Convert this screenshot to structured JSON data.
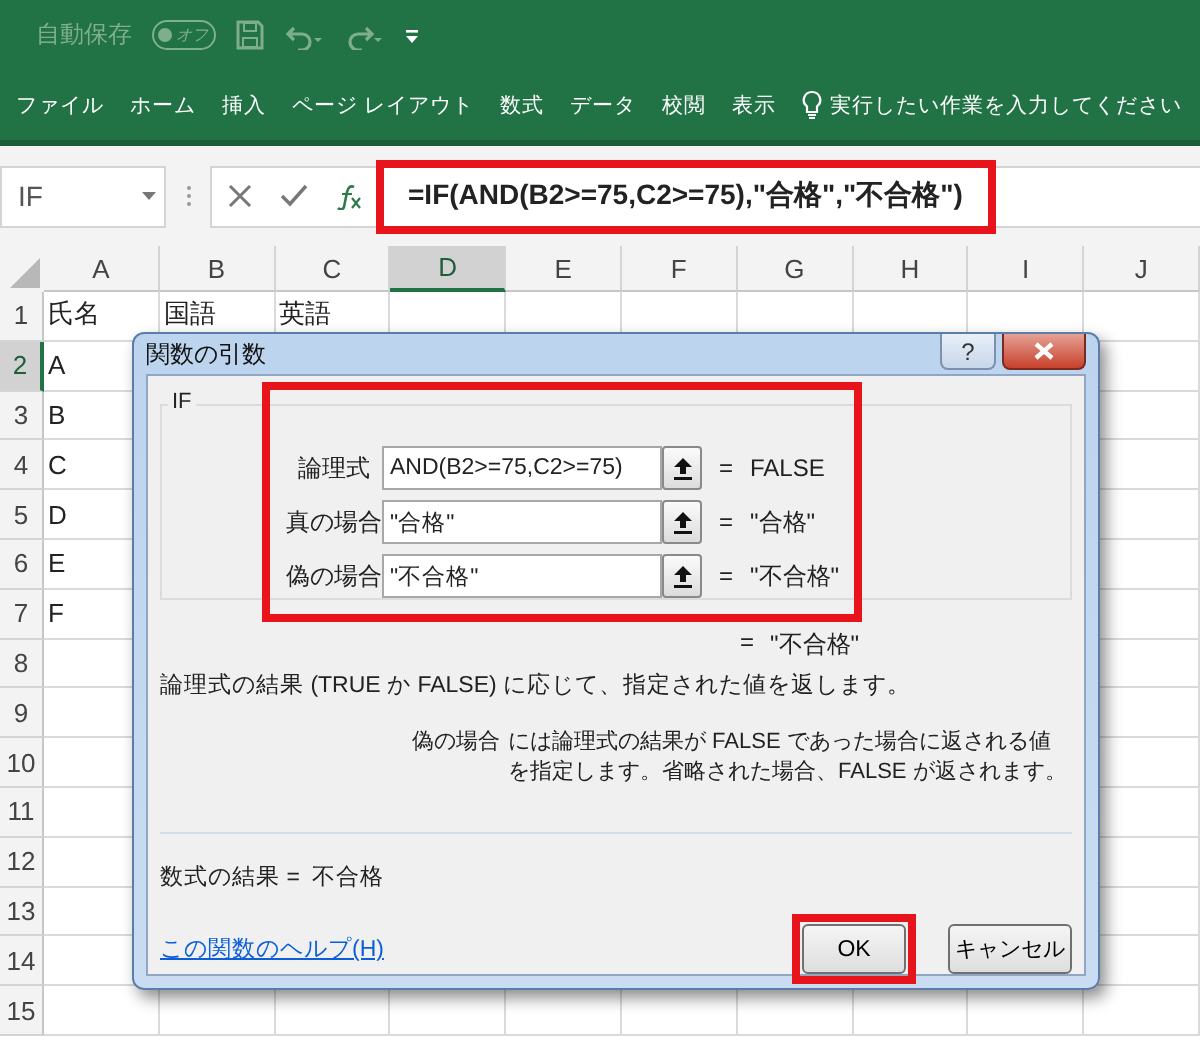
{
  "quick_access": {
    "autosave_label": "自動保存",
    "autosave_state": "オフ",
    "autosave_on": false
  },
  "ribbon_tabs": [
    {
      "label": "ファイル"
    },
    {
      "label": "ホーム"
    },
    {
      "label": "挿入"
    },
    {
      "label": "ページ レイアウト"
    },
    {
      "label": "数式"
    },
    {
      "label": "データ"
    },
    {
      "label": "校閲"
    },
    {
      "label": "表示"
    }
  ],
  "tell_me": "実行したい作業を入力してください",
  "formula_bar": {
    "name_box": "IF",
    "formula": "=IF(AND(B2>=75,C2>=75),\"合格\",\"不合格\")",
    "highlighted": true
  },
  "sheet": {
    "columns": [
      {
        "label": "A",
        "selected": false
      },
      {
        "label": "B",
        "selected": false
      },
      {
        "label": "C",
        "selected": false
      },
      {
        "label": "D",
        "selected": true
      },
      {
        "label": "E",
        "selected": false
      },
      {
        "label": "F",
        "selected": false
      },
      {
        "label": "G",
        "selected": false
      },
      {
        "label": "H",
        "selected": false
      },
      {
        "label": "I",
        "selected": false
      },
      {
        "label": "J",
        "selected": false
      }
    ],
    "rows": [
      {
        "number": "1",
        "selected": false,
        "cells": [
          "氏名",
          "国語",
          "英語"
        ]
      },
      {
        "number": "2",
        "selected": true,
        "cells": [
          "A"
        ]
      },
      {
        "number": "3",
        "selected": false,
        "cells": [
          "B"
        ]
      },
      {
        "number": "4",
        "selected": false,
        "cells": [
          "C"
        ]
      },
      {
        "number": "5",
        "selected": false,
        "cells": [
          "D"
        ]
      },
      {
        "number": "6",
        "selected": false,
        "cells": [
          "E"
        ]
      },
      {
        "number": "7",
        "selected": false,
        "cells": [
          "F"
        ]
      },
      {
        "number": "8",
        "selected": false
      },
      {
        "number": "9",
        "selected": false
      },
      {
        "number": "10",
        "selected": false
      },
      {
        "number": "11",
        "selected": false
      },
      {
        "number": "12",
        "selected": false
      },
      {
        "number": "13",
        "selected": false
      },
      {
        "number": "14",
        "selected": false
      },
      {
        "number": "15",
        "selected": false
      }
    ]
  },
  "dialog": {
    "title": "関数の引数",
    "help_button": "?",
    "function_name": "IF",
    "arguments_highlighted": true,
    "arguments": [
      {
        "label": "論理式",
        "value": "AND(B2>=75,C2>=75)",
        "equals": "=",
        "result": "FALSE"
      },
      {
        "label": "真の場合",
        "value": "\"合格\"",
        "equals": "=",
        "result": "\"合格\""
      },
      {
        "label": "偽の場合",
        "value": "\"不合格\"",
        "equals": "=",
        "result": "\"不合格\""
      }
    ],
    "overall": {
      "equals": "=",
      "result": "\"不合格\""
    },
    "description": "論理式の結果 (TRUE か FALSE) に応じて、指定された値を返します。",
    "argument_help": {
      "name": "偽の場合",
      "text": "には論理式の結果が FALSE であった場合に返される値を指定します。省略された場合、FALSE が返されます。"
    },
    "formula_result": {
      "label": "数式の結果 =",
      "value": "不合格"
    },
    "help_link": "この関数のヘルプ(H)",
    "buttons": [
      {
        "label": "OK",
        "highlighted": true
      },
      {
        "label": "キャンセル",
        "highlighted": false
      }
    ]
  }
}
